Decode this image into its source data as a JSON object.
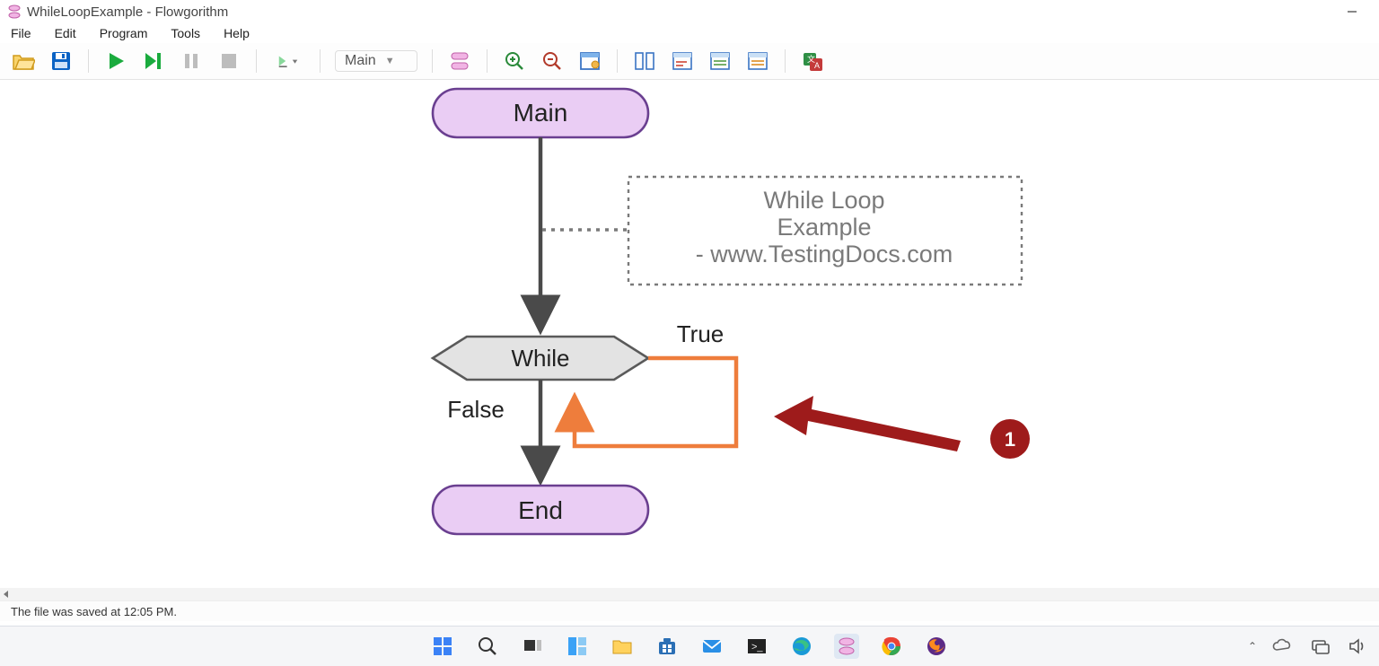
{
  "title": "WhileLoopExample - Flowgorithm",
  "menu": {
    "file": "File",
    "edit": "Edit",
    "program": "Program",
    "tools": "Tools",
    "help": "Help"
  },
  "toolbar": {
    "function_selected": "Main"
  },
  "flowchart": {
    "main_label": "Main",
    "while_label": "While",
    "end_label": "End",
    "true_label": "True",
    "false_label": "False",
    "comment_line1": "While Loop",
    "comment_line2": "Example",
    "comment_line3": "- www.TestingDocs.com",
    "annotation_number": "1"
  },
  "status_text": "The file was saved at 12:05 PM."
}
